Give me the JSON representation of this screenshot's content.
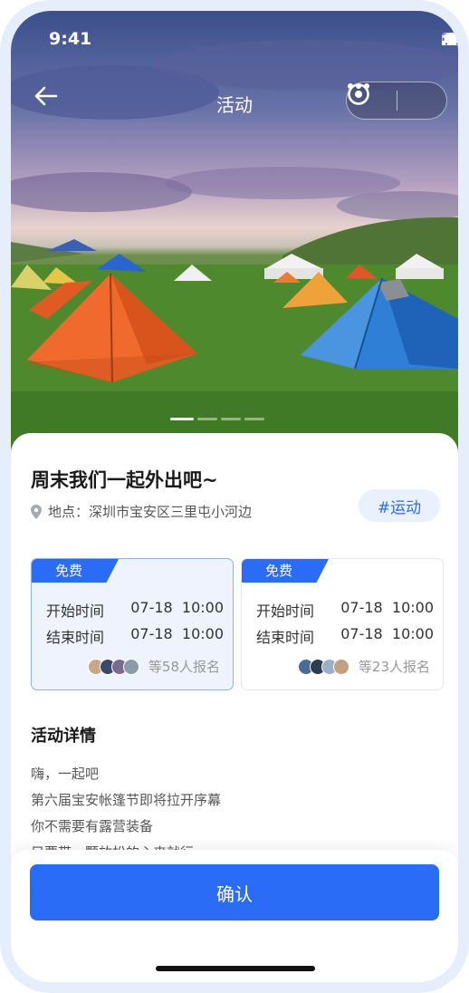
{
  "status_bar": {
    "time": "9:41",
    "icons": [
      "signal-icon",
      "wifi-icon",
      "battery-icon"
    ]
  },
  "nav": {
    "title": "活动",
    "back_icon": "back-arrow-icon",
    "more_icon": "more-dots-icon",
    "close_icon": "target-icon"
  },
  "carousel": {
    "slide_count": 4,
    "active_index": 0
  },
  "activity": {
    "title": "周末我们一起外出吧~",
    "location_label": "地点：",
    "location": "深圳市宝安区三里屯小河边",
    "tag": "#运动"
  },
  "sessions": [
    {
      "badge": "免费",
      "start_label": "开始时间",
      "start_time": "07-18  10:00",
      "end_label": "结束时间",
      "end_time": "07-18  10:00",
      "signup": "等58人报名",
      "selected": true
    },
    {
      "badge": "免费",
      "start_label": "开始时间",
      "start_time": "07-18  10:00",
      "end_label": "结束时间",
      "end_time": "07-18  10:00",
      "signup": "等23人报名",
      "selected": false
    }
  ],
  "details": {
    "title": "活动详情",
    "lines": [
      "嗨，一起吧",
      "第六届宝安帐篷节即将拉开序幕",
      "你不需要有露营装备",
      "只要带一颗放松的心来就行"
    ]
  },
  "footer": {
    "confirm_label": "确认"
  },
  "colors": {
    "accent": "#2a6cf5",
    "tag_bg": "#eaf1fe",
    "selected_card_bg": "#eef3fe"
  }
}
